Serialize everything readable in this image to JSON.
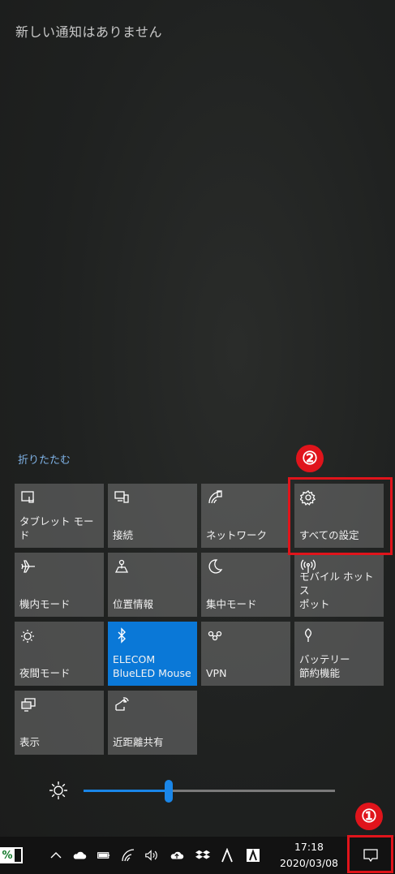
{
  "notifications": {
    "empty_text": "新しい通知はありません",
    "collapse_label": "折りたたむ"
  },
  "tiles": [
    {
      "label": "タブレット モード",
      "icon": "tablet-mode-icon",
      "active": false
    },
    {
      "label": "接続",
      "icon": "connect-icon",
      "active": false
    },
    {
      "label": "ネットワーク",
      "icon": "network-icon",
      "active": false
    },
    {
      "label": "すべての設定",
      "icon": "gear-icon",
      "active": false
    },
    {
      "label": "機内モード",
      "icon": "airplane-icon",
      "active": false
    },
    {
      "label": "位置情報",
      "icon": "location-icon",
      "active": false
    },
    {
      "label": "集中モード",
      "icon": "moon-icon",
      "active": false
    },
    {
      "label": "モバイル ホットス\nポット",
      "icon": "hotspot-icon",
      "active": false
    },
    {
      "label": "夜間モード",
      "icon": "night-light-icon",
      "active": false
    },
    {
      "label": "ELECOM\nBlueLED Mouse",
      "icon": "bluetooth-icon",
      "active": true
    },
    {
      "label": "VPN",
      "icon": "vpn-icon",
      "active": false
    },
    {
      "label": "バッテリー\n節約機能",
      "icon": "battery-saver-icon",
      "active": false
    },
    {
      "label": "表示",
      "icon": "project-icon",
      "active": false
    },
    {
      "label": "近距離共有",
      "icon": "nearby-share-icon",
      "active": false
    }
  ],
  "brightness": {
    "level": 0.34,
    "icon": "brightness-sun-icon"
  },
  "annotations": {
    "callout1": "①",
    "callout2": "②"
  },
  "taskbar": {
    "battery_percent_text": "%",
    "time": "17:18",
    "date": "2020/03/08",
    "tray_icons": [
      "chevron-up-icon",
      "onedrive-icon",
      "battery-icon",
      "wifi-icon",
      "volume-icon",
      "cloud-upload-icon",
      "dropbox-icon",
      "a-icon",
      "adobe-icon"
    ]
  },
  "colors": {
    "accent": "#0a78d7",
    "callout": "#e0141b",
    "link": "#7fb2e6"
  }
}
